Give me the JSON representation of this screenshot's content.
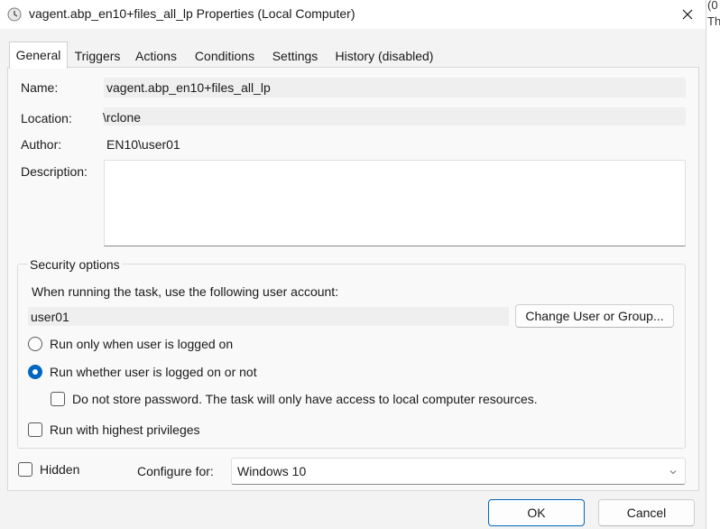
{
  "window": {
    "title": "vagent.abp_en10+files_all_lp Properties (Local Computer)",
    "icon": "clock-icon",
    "close_glyph": "✕"
  },
  "background_window": {
    "text_1": "(0",
    "text_2": "Th"
  },
  "tabs": [
    {
      "label": "General",
      "active": true
    },
    {
      "label": "Triggers",
      "active": false
    },
    {
      "label": "Actions",
      "active": false
    },
    {
      "label": "Conditions",
      "active": false
    },
    {
      "label": "Settings",
      "active": false
    },
    {
      "label": "History (disabled)",
      "active": false
    }
  ],
  "general": {
    "name_label": "Name:",
    "name_value": "vagent.abp_en10+files_all_lp",
    "location_label": "Location:",
    "location_value": "\\rclone",
    "author_label": "Author:",
    "author_value": "EN10\\user01",
    "description_label": "Description:",
    "description_value": ""
  },
  "security": {
    "legend": "Security options",
    "account_prompt": "When running the task, use the following user account:",
    "account_value": "user01",
    "change_button": "Change User or Group...",
    "radio_logged_on": {
      "label": "Run only when user is logged on",
      "checked": false
    },
    "radio_whether": {
      "label": "Run whether user is logged on or not",
      "checked": true
    },
    "no_store_password": {
      "label": "Do not store password.  The task will only have access to local computer resources.",
      "checked": false
    },
    "highest_privileges": {
      "label": "Run with highest privileges",
      "checked": false
    }
  },
  "footer": {
    "hidden": {
      "label": "Hidden",
      "checked": false
    },
    "configure_label": "Configure for:",
    "configure_value": "Windows 10",
    "ok": "OK",
    "cancel": "Cancel"
  },
  "colors": {
    "accent": "#0067c0",
    "window_bg": "#f3f3f3",
    "panel_bg": "#f9f9f9"
  }
}
